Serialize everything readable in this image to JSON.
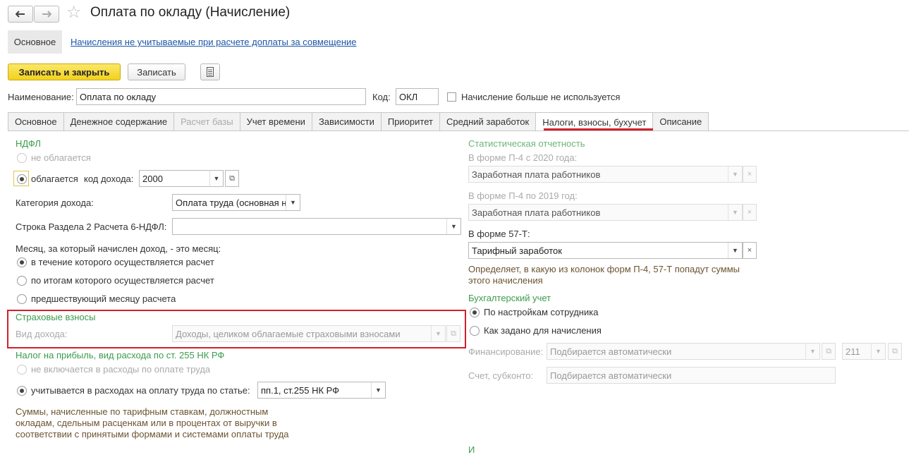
{
  "window": {
    "title": "Оплата по окладу (Начисление)",
    "back_icon": "arrow-left-icon",
    "forward_icon": "arrow-right-icon",
    "favorite_icon": "star-icon"
  },
  "top_nav": {
    "main": "Основное",
    "link": "Начисления не учитываемые при расчете доплаты за совмещение"
  },
  "toolbar": {
    "save_close": "Записать и закрыть",
    "save": "Записать",
    "doc_icon": "document-list-icon"
  },
  "header": {
    "name_label": "Наименование:",
    "name_value": "Оплата по окладу",
    "code_label": "Код:",
    "code_value": "ОКЛ",
    "unused_label": "Начисление больше не используется"
  },
  "tabs": [
    {
      "label": "Основное",
      "disabled": false
    },
    {
      "label": "Денежное содержание",
      "disabled": false
    },
    {
      "label": "Расчет базы",
      "disabled": true
    },
    {
      "label": "Учет времени",
      "disabled": false
    },
    {
      "label": "Зависимости",
      "disabled": false
    },
    {
      "label": "Приоритет",
      "disabled": false
    },
    {
      "label": "Средний заработок",
      "disabled": false
    },
    {
      "label": "Налоги, взносы, бухучет",
      "disabled": false,
      "active": true
    },
    {
      "label": "Описание",
      "disabled": false
    }
  ],
  "ndfl": {
    "title": "НДФЛ",
    "not_taxed": "не облагается",
    "taxed": "облагается",
    "income_code_label": "код дохода:",
    "income_code_value": "2000",
    "category_label": "Категория дохода:",
    "category_value": "Оплата труда (основная н",
    "line_label": "Строка Раздела 2 Расчета 6-НДФЛ:",
    "line_value": "",
    "month_question": "Месяц, за который начислен доход, - это месяц:",
    "month_options": [
      "в течение которого осуществляется расчет",
      "по итогам которого осуществляется расчет",
      "предшествующий месяцу расчета"
    ]
  },
  "insurance": {
    "title": "Страховые взносы",
    "income_type_label": "Вид дохода:",
    "income_type_value": "Доходы, целиком облагаемые страховыми взносами"
  },
  "profit_tax": {
    "title": "Налог на прибыль, вид расхода по ст. 255 НК РФ",
    "not_included": "не включается в расходы по оплате труда",
    "included": "учитывается в расходах на оплату труда по статье:",
    "article_value": "пп.1, ст.255 НК РФ",
    "note": [
      "Суммы, начисленные по тарифным ставкам, должностным",
      "окладам, сдельным расценкам или в процентах от выручки в",
      "соответствии с принятыми формами и системами оплаты труда"
    ]
  },
  "stats": {
    "title": "Статистическая отчетность",
    "p4_2020_label": "В форме П-4 с 2020 года:",
    "p4_2020_value": "Заработная плата работников",
    "p4_2019_label": "В форме П-4 по 2019 год:",
    "p4_2019_value": "Заработная плата работников",
    "f57_label": "В форме 57-Т:",
    "f57_value": "Тарифный заработок",
    "note": [
      "Определяет, в какую из колонок форм П-4, 57-Т попадут суммы",
      "этого начисления"
    ]
  },
  "accounting": {
    "title": "Бухгалтерский учет",
    "by_employee": "По настройкам сотрудника",
    "as_set": "Как задано для начисления",
    "financing_label": "Финансирование:",
    "financing_value": "Подбирается автоматически",
    "financing_code": "211",
    "account_label": "Счет, субконто:",
    "account_value": "Подбирается автоматически",
    "cut_off_letter": "И"
  },
  "colors": {
    "accent_green": "#3a9c4c",
    "highlight_red": "#d0202b",
    "primary_yellow": "#f2d21f",
    "link_blue": "#1b56a8"
  }
}
